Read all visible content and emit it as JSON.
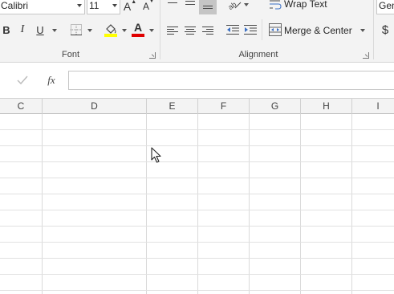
{
  "font_group": {
    "font_name": "Calibri",
    "font_size": "11",
    "grow_label": "A",
    "shrink_label": "A",
    "bold_label": "B",
    "italic_label": "I",
    "underline_label": "U",
    "fill_letter": "",
    "font_color_letter": "A",
    "group_label": "Font",
    "fill_color": "#ffff00",
    "font_color": "#e00000"
  },
  "alignment_group": {
    "wrap_text_label": "Wrap Text",
    "merge_center_label": "Merge & Center",
    "group_label": "Alignment"
  },
  "number_group": {
    "format_value": "Gen",
    "currency_label": "$"
  },
  "formula_bar": {
    "cancel_icon": "check-icon",
    "fx_label": "fx",
    "value": ""
  },
  "columns": [
    "C",
    "D",
    "E",
    "F",
    "G",
    "H",
    "I"
  ]
}
